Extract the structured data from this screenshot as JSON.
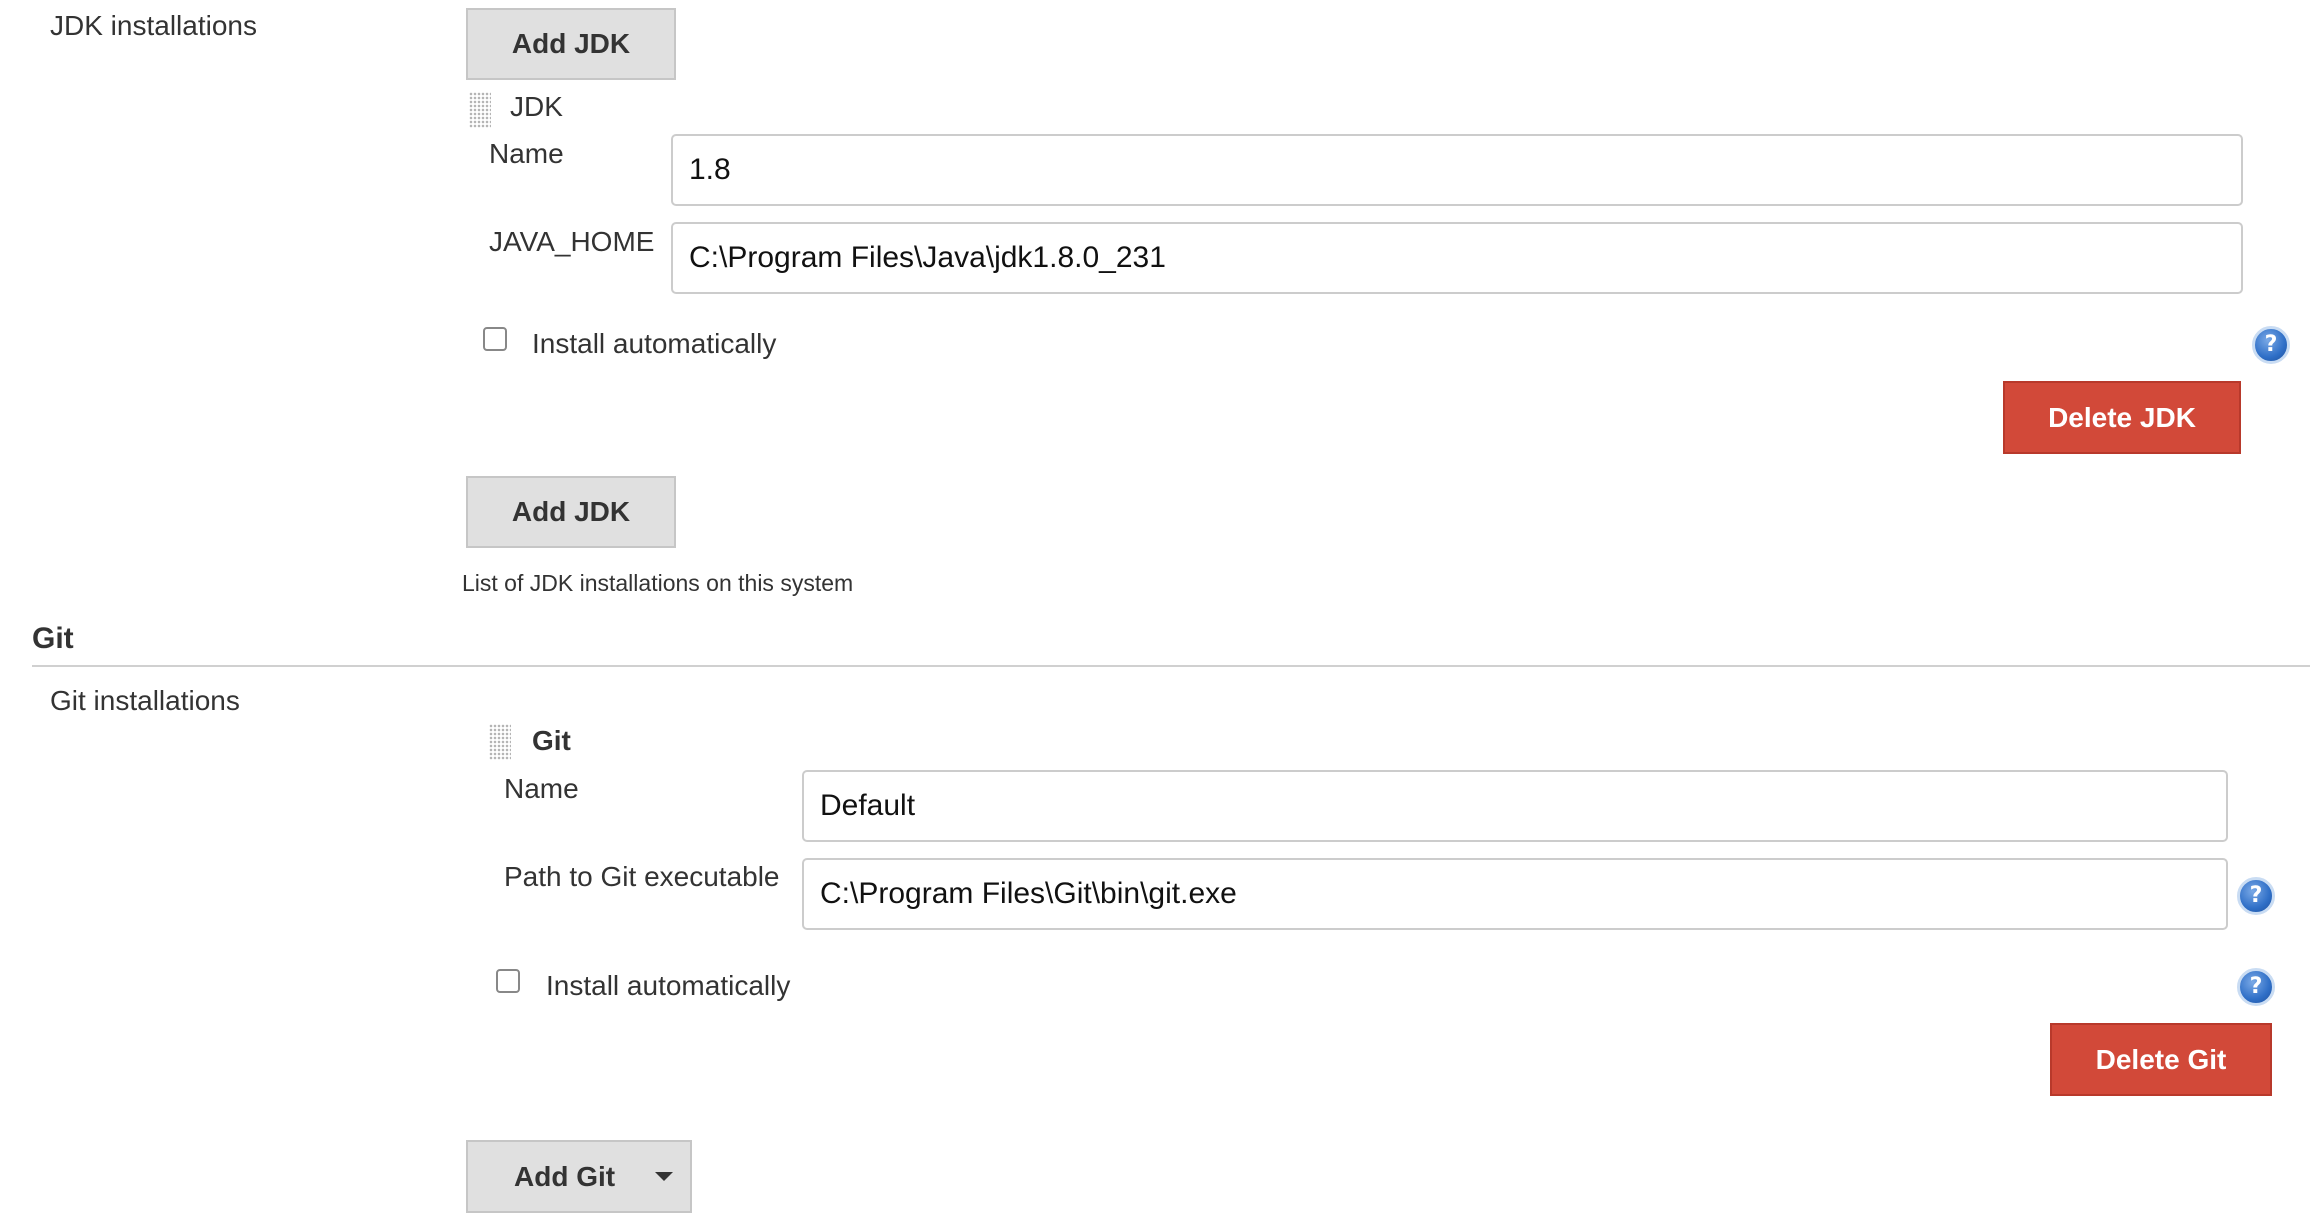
{
  "jdk": {
    "section_label": "JDK installations",
    "add_button_top": "Add JDK",
    "item_title": "JDK",
    "name_label": "Name",
    "name_value": "1.8",
    "java_home_label": "JAVA_HOME",
    "java_home_value": "C:\\Program Files\\Java\\jdk1.8.0_231",
    "install_auto_label": "Install automatically",
    "delete_button": "Delete JDK",
    "add_button_bottom": "Add JDK",
    "description": "List of JDK installations on this system"
  },
  "git": {
    "heading": "Git",
    "section_label": "Git installations",
    "item_title": "Git",
    "name_label": "Name",
    "name_value": "Default",
    "path_label": "Path to Git executable",
    "path_value": "C:\\Program Files\\Git\\bin\\git.exe",
    "install_auto_label": "Install automatically",
    "delete_button": "Delete Git",
    "add_button": "Add Git"
  },
  "help_glyph": "?",
  "icons": {
    "help": "help-icon",
    "drag": "drag-handle-icon",
    "dropdown": "caret-down-icon"
  },
  "colors": {
    "delete_button": "#d24939",
    "help_icon": "#2f6fc7",
    "grey_button": "#e0e0e0"
  }
}
